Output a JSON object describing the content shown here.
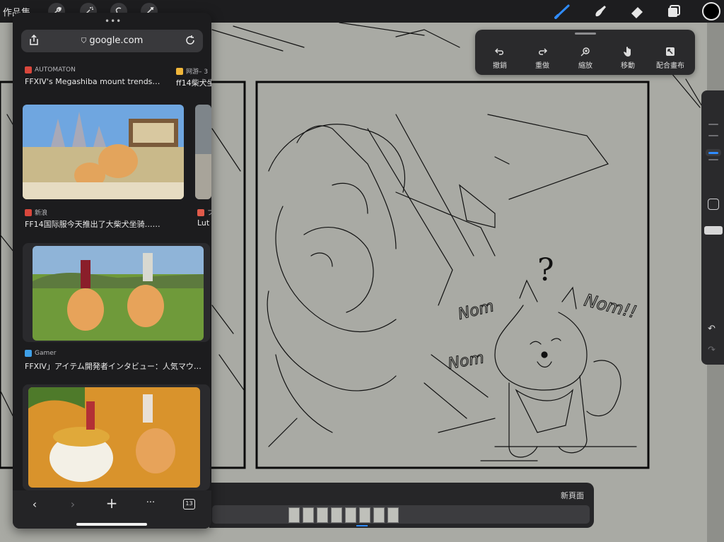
{
  "topbar": {
    "gallery_label": "作品集",
    "left_icons": [
      "wrench-icon",
      "magic-wand-icon",
      "selection-icon",
      "transform-arrow-icon"
    ],
    "tools": [
      "brush-icon",
      "smudge-icon",
      "eraser-icon",
      "layers-icon"
    ],
    "color": "#000000"
  },
  "quickmenu": {
    "items": [
      {
        "label": "撤銷",
        "icon": "undo-icon"
      },
      {
        "label": "重做",
        "icon": "redo-icon"
      },
      {
        "label": "縮放",
        "icon": "zoom-icon"
      },
      {
        "label": "移動",
        "icon": "hand-icon"
      },
      {
        "label": "配合畫布",
        "icon": "fit-canvas-icon"
      }
    ]
  },
  "framebar": {
    "new_page_label": "新頁面",
    "thumb_count": 8
  },
  "safari": {
    "url": "google.com",
    "results": [
      {
        "source": "AUTOMATON",
        "headline": "FFXIV's Megashiba mount trends…",
        "fav_color": "#d9473c"
      },
      {
        "source": "网游– 3",
        "headline": "ff14柴犬坐",
        "fav_color": "#f0b63a"
      },
      {
        "source": "新浪",
        "headline": "FF14国际服今天推出了大柴犬坐骑……",
        "fav_color": "#d9473c"
      },
      {
        "source": "フ",
        "headline": "Lut",
        "fav_color": "#e05a4a"
      },
      {
        "source": "Gamer",
        "headline": "FFXIV」アイテム開発者インタビュー：人気マウ…",
        "fav_color": "#3fa0e8"
      }
    ],
    "toolbar": {
      "back_label": "‹",
      "forward_label": "›",
      "new_tab_label": "+",
      "more_label": "···",
      "tabs_count": "13"
    }
  },
  "canvas_text": {
    "question": "?",
    "nom1": "Nom",
    "nom2": "Nom!!",
    "nom3": "Nom"
  }
}
